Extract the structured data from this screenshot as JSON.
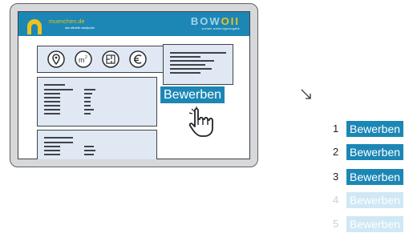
{
  "header": {
    "logo_text": "muenchen.de",
    "logo_subtext": "das offizielle stadtportal",
    "brand_left": "BOW",
    "brand_right": "OII",
    "brand_subtext": "soziale wohnungsvergabe"
  },
  "icons": [
    "location-pin-icon",
    "square-meter-icon",
    "floor-plan-icon",
    "euro-icon"
  ],
  "cta": {
    "label": "Bewerben"
  },
  "steps": [
    {
      "number": "1",
      "label": "Bewerben",
      "state": "active"
    },
    {
      "number": "2",
      "label": "Bewerben",
      "state": "active"
    },
    {
      "number": "3",
      "label": "Bewerben",
      "state": "active"
    },
    {
      "number": "4",
      "label": "Bewerben",
      "state": "faded"
    },
    {
      "number": "5",
      "label": "Bewerben",
      "state": "faded"
    }
  ],
  "colors": {
    "accent": "#1c87b5",
    "card_bg": "#dfe8f3",
    "logo_yellow": "#f0c21d",
    "faded": "#cfe8f5"
  }
}
